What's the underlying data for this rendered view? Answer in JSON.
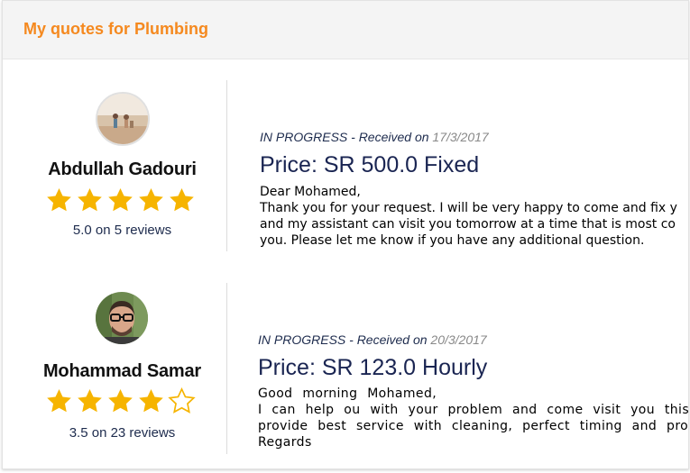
{
  "header": {
    "title": "My quotes for Plumbing"
  },
  "quotes": [
    {
      "provider": "Abdullah Gadouri",
      "rating_value": 5.0,
      "rating_text": "5.0 on 5 reviews",
      "status": "IN PROGRESS",
      "received_label": " - Received on ",
      "date": "17/3/2017",
      "price": "Price: SR 500.0 Fixed",
      "message_lines": [
        "Dear Mohamed,",
        "Thank you for your request. I will be very happy to come and fix y",
        "and my assistant can visit you tomorrow at a time that is most co",
        "you. Please let me know if you have any additional question."
      ],
      "stars": [
        "full",
        "full",
        "full",
        "full",
        "full"
      ]
    },
    {
      "provider": "Mohammad Samar",
      "rating_value": 3.5,
      "rating_text": "3.5 on 23 reviews",
      "status": "IN PROGRESS",
      "received_label": " - Received on ",
      "date": "20/3/2017",
      "price": "Price: SR 123.0 Hourly",
      "message_lines": [
        "Good morning Mohamed,",
        "I can help ou with your problem and come visit you this afte",
        "provide best service with cleaning, perfect timing and pro",
        "Regards"
      ],
      "stars": [
        "full",
        "full",
        "full",
        "full",
        "empty"
      ]
    }
  ],
  "colors": {
    "accent": "#f5891f",
    "star": "#f6b400",
    "price": "#1a2552"
  }
}
